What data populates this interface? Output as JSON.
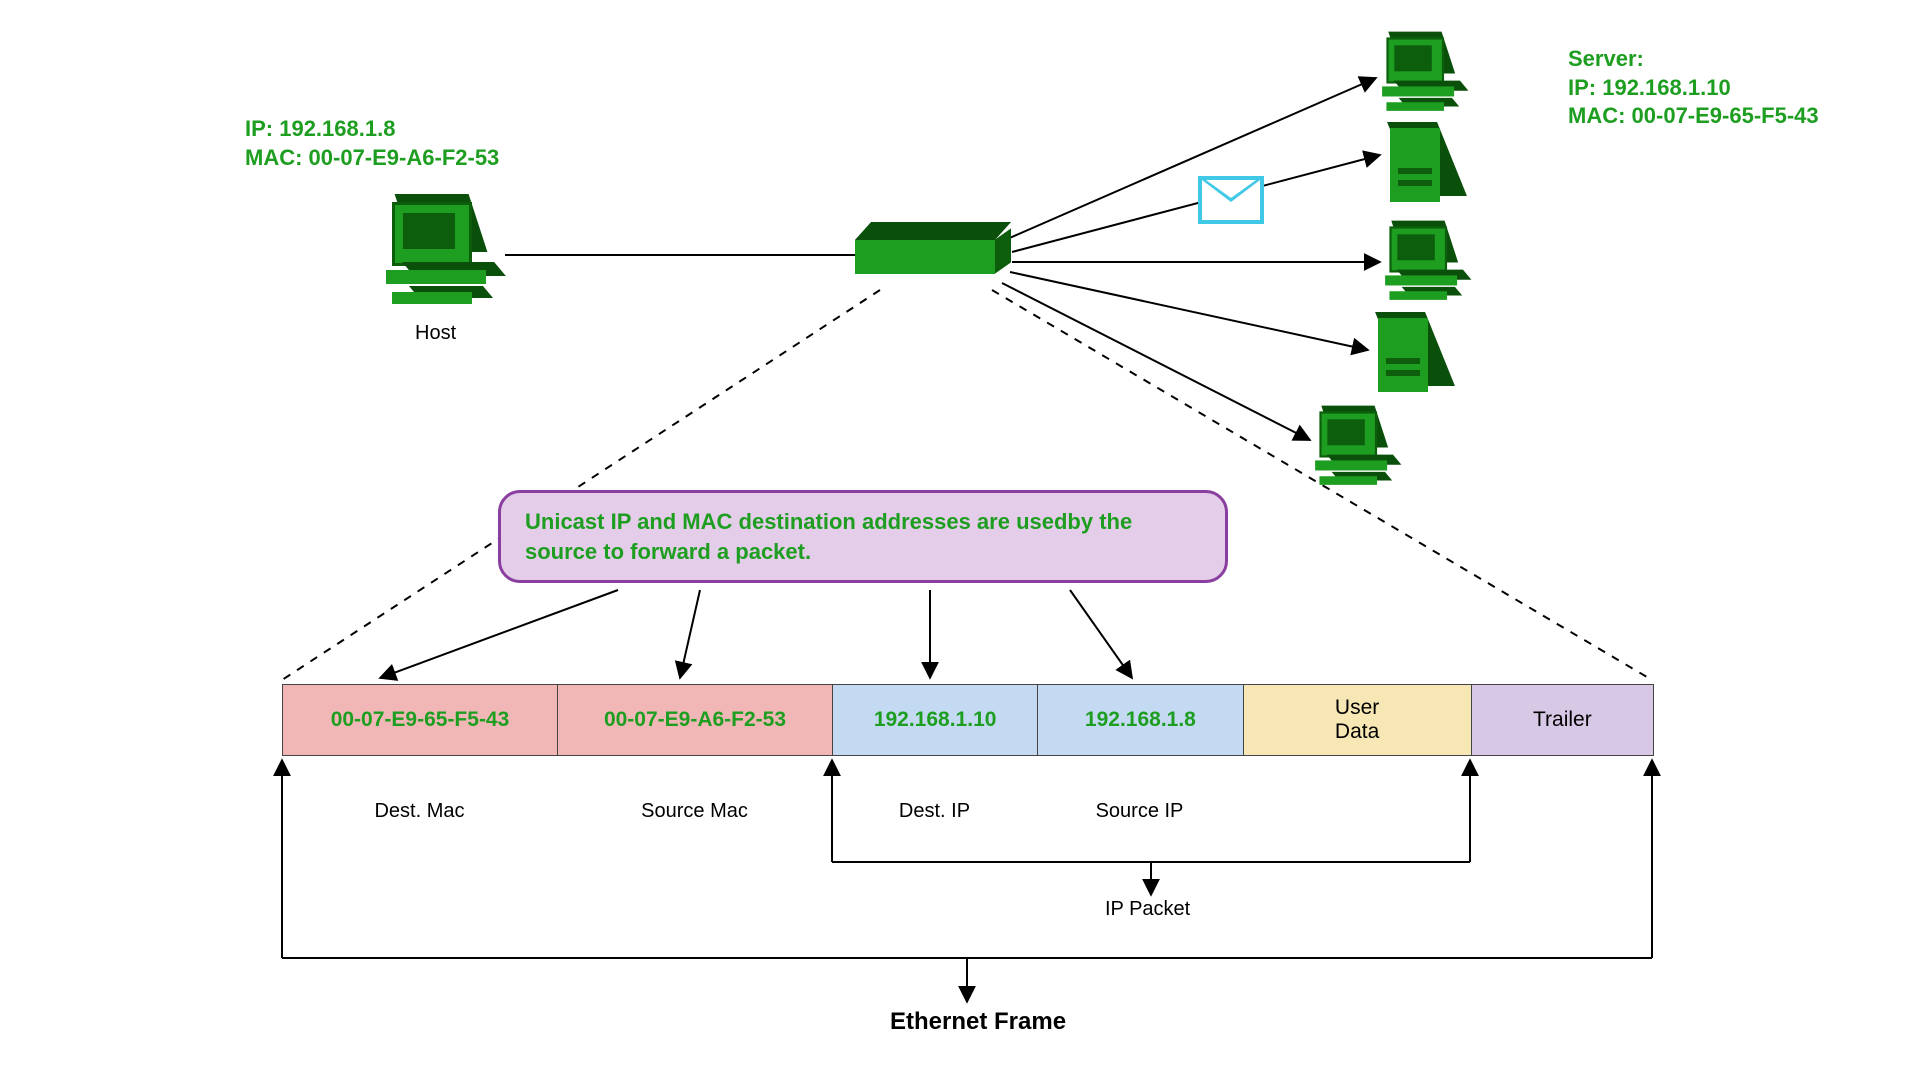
{
  "host": {
    "label": "Host",
    "ip_line": "IP: 192.168.1.8",
    "mac_line": "MAC: 00-07-E9-A6-F2-53"
  },
  "server": {
    "label": "Server:",
    "ip_line": "IP: 192.168.1.10",
    "mac_line": "MAC: 00-07-E9-65-F5-43"
  },
  "callout": {
    "text": "Unicast IP and MAC destination addresses are usedby the source to forward a packet."
  },
  "frame": {
    "dest_mac_value": "00-07-E9-65-F5-43",
    "src_mac_value": "00-07-E9-A6-F2-53",
    "dest_ip_value": "192.168.1.10",
    "src_ip_value": "192.168.1.8",
    "user_data_label": "User\nData",
    "trailer_label": "Trailer"
  },
  "sublabels": {
    "dest_mac": "Dest. Mac",
    "src_mac": "Source Mac",
    "dest_ip": "Dest. IP",
    "src_ip": "Source IP"
  },
  "bracket_labels": {
    "ip_packet": "IP Packet",
    "ethernet_frame": "Ethernet Frame"
  },
  "icons": {
    "switch": "switch-icon",
    "computer": "computer-icon",
    "server": "server-icon",
    "envelope": "envelope-icon"
  }
}
